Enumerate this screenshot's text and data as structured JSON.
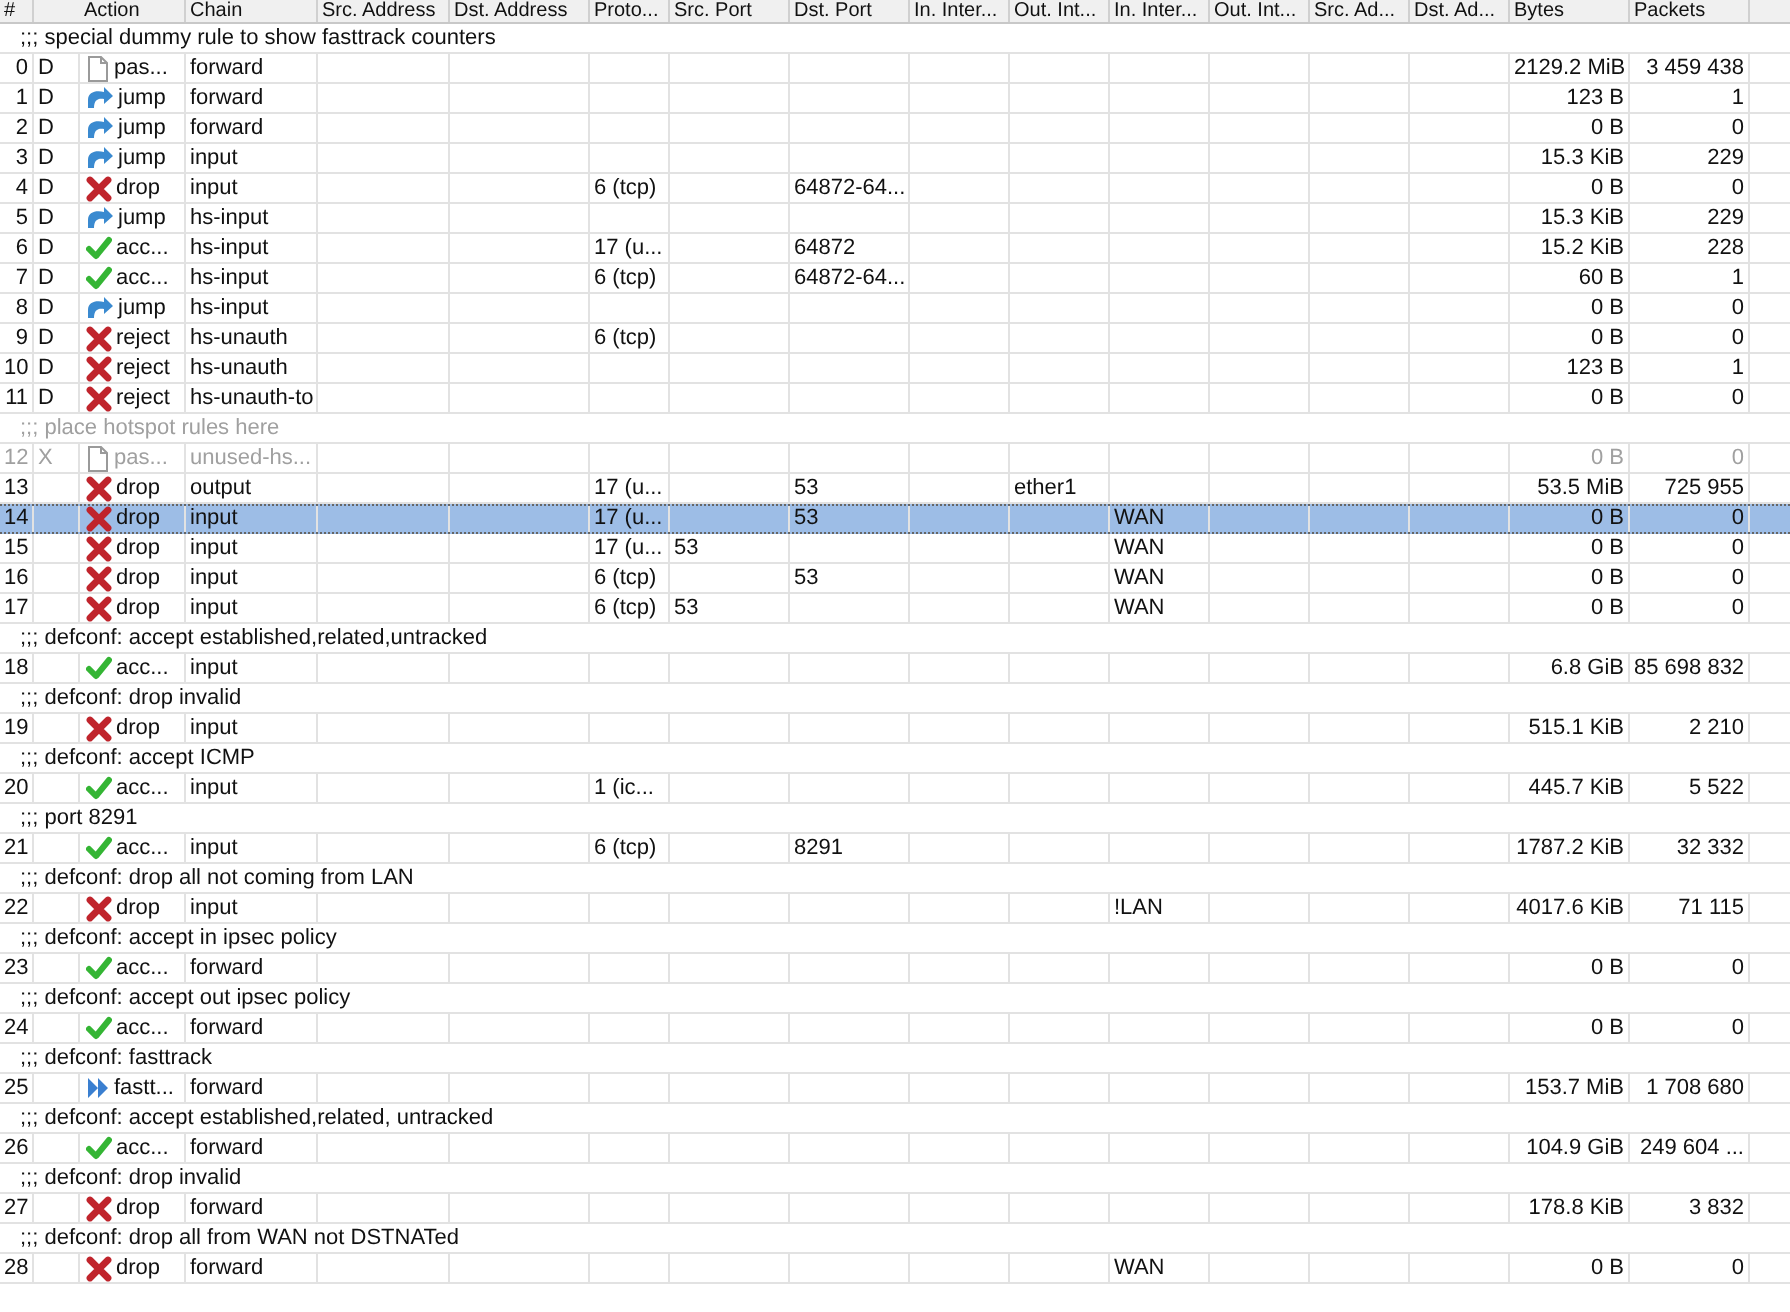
{
  "table": {
    "columns": [
      "#",
      "Action",
      "Chain",
      "Src. Address",
      "Dst. Address",
      "Proto...",
      "Src. Port",
      "Dst. Port",
      "In. Inter...",
      "Out. Int...",
      "In. Inter...",
      "Out. Int...",
      "Src. Ad...",
      "Dst. Ad...",
      "Bytes",
      "Packets"
    ],
    "rows": [
      {
        "kind": "comment",
        "text": ";;; special dummy rule to show fasttrack counters",
        "disabled": false
      },
      {
        "kind": "pass",
        "number": "0",
        "flag": "D",
        "action": "pas...",
        "chain": "forward",
        "bytes": "2129.2 MiB",
        "packets": "3 459 438",
        "selected": false,
        "disabled": false
      },
      {
        "kind": "jump",
        "number": "1",
        "flag": "D",
        "action": "jump",
        "chain": "forward",
        "bytes": "123 B",
        "packets": "1",
        "selected": false,
        "disabled": false
      },
      {
        "kind": "jump",
        "number": "2",
        "flag": "D",
        "action": "jump",
        "chain": "forward",
        "bytes": "0 B",
        "packets": "0",
        "selected": false,
        "disabled": false
      },
      {
        "kind": "jump",
        "number": "3",
        "flag": "D",
        "action": "jump",
        "chain": "input",
        "bytes": "15.3 KiB",
        "packets": "229",
        "selected": false,
        "disabled": false
      },
      {
        "kind": "drop",
        "number": "4",
        "flag": "D",
        "action": "drop",
        "chain": "input",
        "proto": "6 (tcp)",
        "dst_port": "64872-64...",
        "bytes": "0 B",
        "packets": "0",
        "selected": false,
        "disabled": false
      },
      {
        "kind": "jump",
        "number": "5",
        "flag": "D",
        "action": "jump",
        "chain": "hs-input",
        "bytes": "15.3 KiB",
        "packets": "229",
        "selected": false,
        "disabled": false
      },
      {
        "kind": "accept",
        "number": "6",
        "flag": "D",
        "action": "acc...",
        "chain": "hs-input",
        "proto": "17 (u...",
        "dst_port": "64872",
        "bytes": "15.2 KiB",
        "packets": "228",
        "selected": false,
        "disabled": false
      },
      {
        "kind": "accept",
        "number": "7",
        "flag": "D",
        "action": "acc...",
        "chain": "hs-input",
        "proto": "6 (tcp)",
        "dst_port": "64872-64...",
        "bytes": "60 B",
        "packets": "1",
        "selected": false,
        "disabled": false
      },
      {
        "kind": "jump",
        "number": "8",
        "flag": "D",
        "action": "jump",
        "chain": "hs-input",
        "bytes": "0 B",
        "packets": "0",
        "selected": false,
        "disabled": false
      },
      {
        "kind": "drop",
        "number": "9",
        "flag": "D",
        "action": "reject",
        "chain": "hs-unauth",
        "proto": "6 (tcp)",
        "bytes": "0 B",
        "packets": "0",
        "selected": false,
        "disabled": false
      },
      {
        "kind": "drop",
        "number": "10",
        "flag": "D",
        "action": "reject",
        "chain": "hs-unauth",
        "bytes": "123 B",
        "packets": "1",
        "selected": false,
        "disabled": false
      },
      {
        "kind": "drop",
        "number": "11",
        "flag": "D",
        "action": "reject",
        "chain": "hs-unauth-to",
        "bytes": "0 B",
        "packets": "0",
        "selected": false,
        "disabled": false
      },
      {
        "kind": "comment",
        "text": ";;; place hotspot rules here",
        "disabled": true
      },
      {
        "kind": "pass",
        "number": "12",
        "flag": "X",
        "action": "pas...",
        "chain": "unused-hs...",
        "bytes": "0 B",
        "packets": "0",
        "selected": false,
        "disabled": true
      },
      {
        "kind": "drop",
        "number": "13",
        "action": "drop",
        "chain": "output",
        "proto": "17 (u...",
        "dst_port": "53",
        "out_int": "ether1",
        "bytes": "53.5 MiB",
        "packets": "725 955",
        "selected": false,
        "disabled": false
      },
      {
        "kind": "drop",
        "number": "14",
        "action": "drop",
        "chain": "input",
        "proto": "17 (u...",
        "dst_port": "53",
        "in_inter_2": "WAN",
        "bytes": "0 B",
        "packets": "0",
        "selected": true,
        "disabled": false
      },
      {
        "kind": "drop",
        "number": "15",
        "action": "drop",
        "chain": "input",
        "proto": "17 (u...",
        "src_port": "53",
        "in_inter_2": "WAN",
        "bytes": "0 B",
        "packets": "0",
        "selected": false,
        "disabled": false
      },
      {
        "kind": "drop",
        "number": "16",
        "action": "drop",
        "chain": "input",
        "proto": "6 (tcp)",
        "dst_port": "53",
        "in_inter_2": "WAN",
        "bytes": "0 B",
        "packets": "0",
        "selected": false,
        "disabled": false
      },
      {
        "kind": "drop",
        "number": "17",
        "action": "drop",
        "chain": "input",
        "proto": "6 (tcp)",
        "src_port": "53",
        "in_inter_2": "WAN",
        "bytes": "0 B",
        "packets": "0",
        "selected": false,
        "disabled": false
      },
      {
        "kind": "comment",
        "text": ";;; defconf: accept established,related,untracked",
        "disabled": false
      },
      {
        "kind": "accept",
        "number": "18",
        "action": "acc...",
        "chain": "input",
        "bytes": "6.8 GiB",
        "packets": "85 698 832",
        "selected": false,
        "disabled": false
      },
      {
        "kind": "comment",
        "text": ";;; defconf: drop invalid",
        "disabled": false
      },
      {
        "kind": "drop",
        "number": "19",
        "action": "drop",
        "chain": "input",
        "bytes": "515.1 KiB",
        "packets": "2 210",
        "selected": false,
        "disabled": false
      },
      {
        "kind": "comment",
        "text": ";;; defconf: accept ICMP",
        "disabled": false
      },
      {
        "kind": "accept",
        "number": "20",
        "action": "acc...",
        "chain": "input",
        "proto": "1 (ic...",
        "bytes": "445.7 KiB",
        "packets": "5 522",
        "selected": false,
        "disabled": false
      },
      {
        "kind": "comment",
        "text": ";;; port 8291",
        "disabled": false
      },
      {
        "kind": "accept",
        "number": "21",
        "action": "acc...",
        "chain": "input",
        "proto": "6 (tcp)",
        "dst_port": "8291",
        "bytes": "1787.2 KiB",
        "packets": "32 332",
        "selected": false,
        "disabled": false
      },
      {
        "kind": "comment",
        "text": ";;; defconf: drop all not coming from LAN",
        "disabled": false
      },
      {
        "kind": "drop",
        "number": "22",
        "action": "drop",
        "chain": "input",
        "in_inter_2": "!LAN",
        "bytes": "4017.6 KiB",
        "packets": "71 115",
        "selected": false,
        "disabled": false
      },
      {
        "kind": "comment",
        "text": ";;; defconf: accept in ipsec policy",
        "disabled": false
      },
      {
        "kind": "accept",
        "number": "23",
        "action": "acc...",
        "chain": "forward",
        "bytes": "0 B",
        "packets": "0",
        "selected": false,
        "disabled": false
      },
      {
        "kind": "comment",
        "text": ";;; defconf: accept out ipsec policy",
        "disabled": false
      },
      {
        "kind": "accept",
        "number": "24",
        "action": "acc...",
        "chain": "forward",
        "bytes": "0 B",
        "packets": "0",
        "selected": false,
        "disabled": false
      },
      {
        "kind": "comment",
        "text": ";;; defconf: fasttrack",
        "disabled": false
      },
      {
        "kind": "fasttrack",
        "number": "25",
        "action": "fastt...",
        "chain": "forward",
        "bytes": "153.7 MiB",
        "packets": "1 708 680",
        "selected": false,
        "disabled": false
      },
      {
        "kind": "comment",
        "text": ";;; defconf: accept established,related, untracked",
        "disabled": false
      },
      {
        "kind": "accept",
        "number": "26",
        "action": "acc...",
        "chain": "forward",
        "bytes": "104.9 GiB",
        "packets": "249 604 ...",
        "selected": false,
        "disabled": false
      },
      {
        "kind": "comment",
        "text": ";;; defconf: drop invalid",
        "disabled": false
      },
      {
        "kind": "drop",
        "number": "27",
        "action": "drop",
        "chain": "forward",
        "bytes": "178.8 KiB",
        "packets": "3 832",
        "selected": false,
        "disabled": false
      },
      {
        "kind": "comment",
        "text": ";;; defconf: drop all from WAN not DSTNATed",
        "disabled": false
      },
      {
        "kind": "drop",
        "number": "28",
        "action": "drop",
        "chain": "forward",
        "in_inter_2": "WAN",
        "bytes": "0 B",
        "packets": "0",
        "selected": false,
        "disabled": false
      }
    ]
  }
}
